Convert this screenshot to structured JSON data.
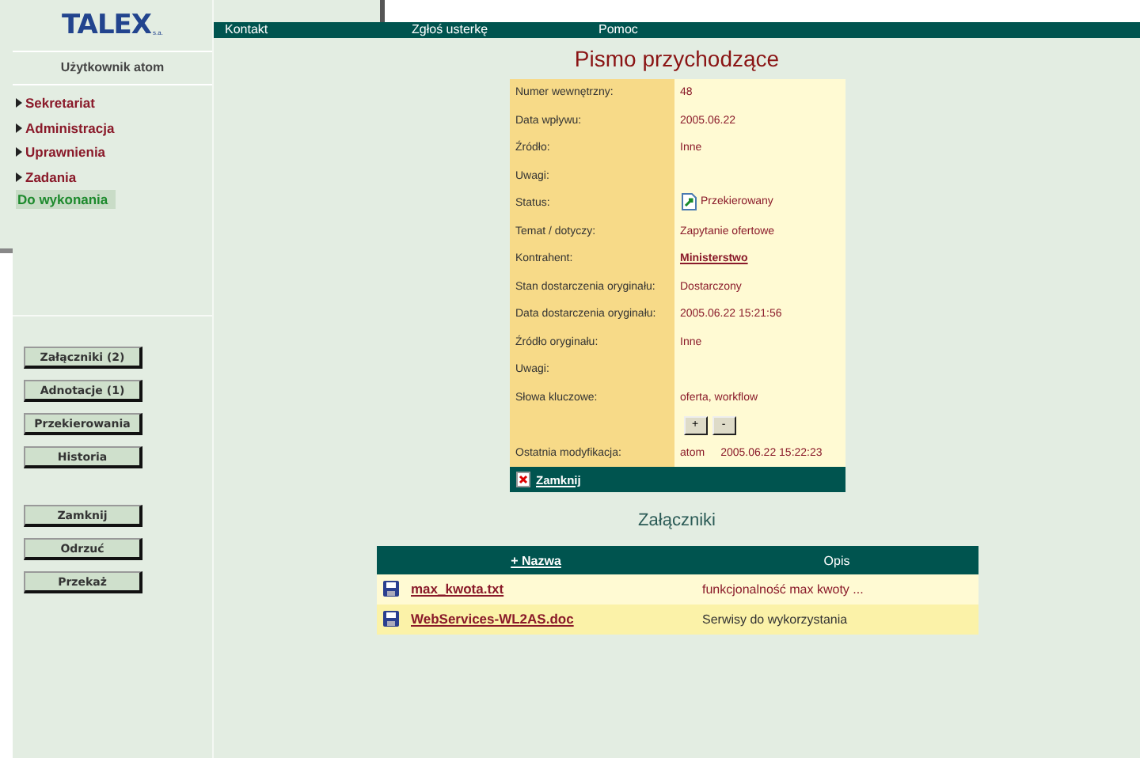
{
  "sidebar": {
    "logo": {
      "text": "TALEX",
      "suffix": "s.a."
    },
    "user": "Użytkownik atom",
    "menu": [
      {
        "label": "Sekretariat",
        "selected": false
      },
      {
        "label": "Administracja",
        "selected": false
      },
      {
        "label": "Uprawnienia",
        "selected": false
      },
      {
        "label": "Zadania",
        "selected": false
      },
      {
        "label": "Do wykonania",
        "selected": true
      }
    ],
    "button_groups": [
      [
        "Załączniki (2)",
        "Adnotacje (1)",
        "Przekierowania",
        "Historia"
      ],
      [
        "Zamknij",
        "Odrzuć",
        "Przekaż"
      ]
    ]
  },
  "nav": [
    "Kontakt",
    "Zgłoś usterkę",
    "Pomoc"
  ],
  "title": "Pismo przychodzące",
  "details": [
    {
      "kind": "text",
      "label": "Numer wewnętrzny:",
      "value": "48"
    },
    {
      "kind": "text",
      "label": "Data wpływu:",
      "value": "2005.06.22"
    },
    {
      "kind": "text",
      "label": "Źródło:",
      "value": "Inne"
    },
    {
      "kind": "text",
      "label": "Uwagi:"
    },
    {
      "kind": "status",
      "label": "Status:",
      "value": "Przekierowany"
    },
    {
      "kind": "text",
      "label": "Temat / dotyczy:",
      "value": "Zapytanie ofertowe"
    },
    {
      "kind": "link",
      "label": "Kontrahent:",
      "value": "Ministerstwo"
    },
    {
      "kind": "text",
      "label": "Stan dostarczenia oryginału:",
      "value": "Dostarczony"
    },
    {
      "kind": "text",
      "label": "Data dostarczenia oryginału:",
      "value": "2005.06.22 15:21:56"
    },
    {
      "kind": "text",
      "label": "Źródło oryginału:",
      "value": "Inne"
    },
    {
      "kind": "text",
      "label": "Uwagi:"
    },
    {
      "kind": "text",
      "label": "Słowa kluczowe:",
      "value": "oferta, workflow"
    },
    {
      "kind": "buttons",
      "buttons": [
        "+",
        "-"
      ]
    },
    {
      "kind": "modified",
      "label": "Ostatnia modyfikacja:",
      "value": "atom",
      "value_2": "2005.06.22 15:22:23"
    }
  ],
  "close_link": "Zamknij",
  "attachments": {
    "title": "Załączniki",
    "columns": [
      "+ Nazwa",
      "Opis"
    ],
    "rows": [
      {
        "name": "max_kwota.txt",
        "description": "funkcjonalność max kwoty ..."
      },
      {
        "name": "WebServices-WL2AS.doc",
        "description": "Serwisy do wykorzystania"
      }
    ]
  }
}
